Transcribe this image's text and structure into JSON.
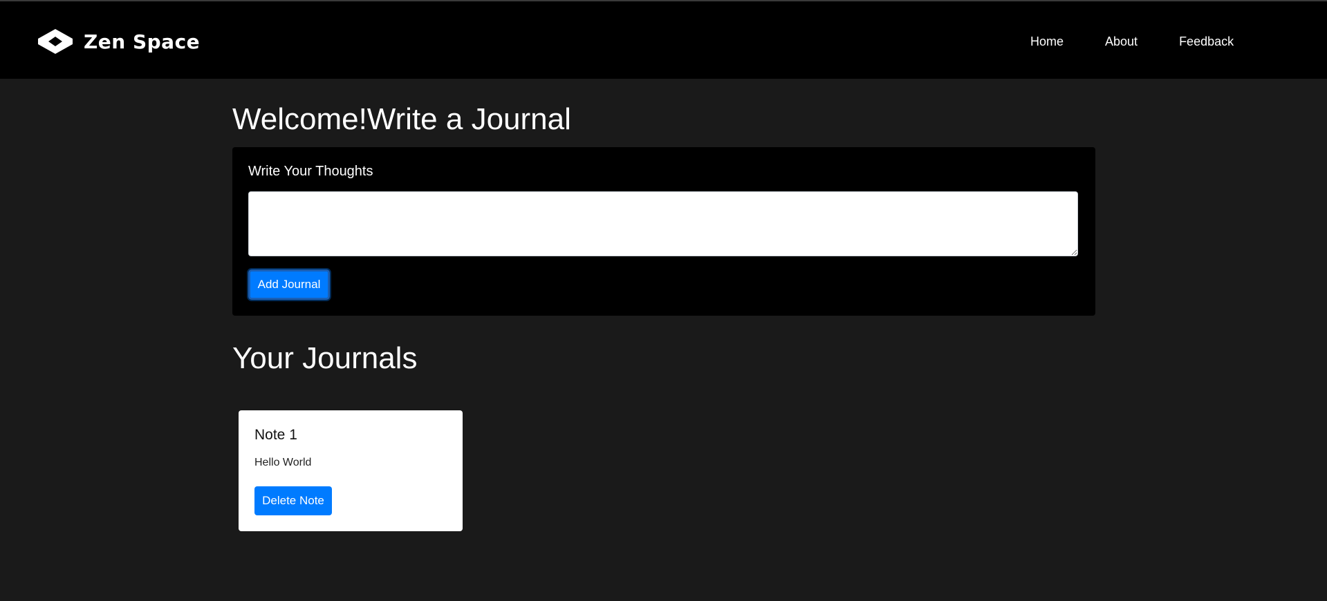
{
  "navbar": {
    "brand_name": "Zen Space",
    "brand_icon": "diamond-logo-icon",
    "links": [
      "Home",
      "About",
      "Feedback"
    ]
  },
  "main": {
    "heading": "Welcome!Write a Journal",
    "write_label": "Write Your Thoughts",
    "textarea_value": "",
    "add_button_label": "Add Journal",
    "journals_heading": "Your Journals",
    "notes": [
      {
        "title": "Note 1",
        "text": "Hello World",
        "delete_label": "Delete Note"
      }
    ]
  },
  "colors": {
    "page_background": "#1a1a1a",
    "navbar_background": "#000000",
    "card_background": "#000000",
    "primary_button": "#007bff",
    "note_card_background": "#ffffff"
  }
}
